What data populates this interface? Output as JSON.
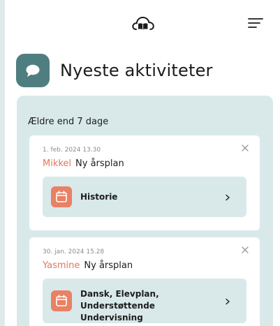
{
  "header": {
    "logo_icon": "cloud-book-icon",
    "menu_icon": "hamburger-menu-icon"
  },
  "page": {
    "title": "Nyeste aktiviteter",
    "title_icon": "chat-bubble-icon",
    "accent_color": "#4f7e80"
  },
  "activities": {
    "section_label": "Ældre end 7 dage",
    "items": [
      {
        "timestamp": "1. feb. 2024 13.30",
        "name": "Mikkel",
        "action": "Ny årsplan",
        "subject": "Historie",
        "close_icon": "close-icon",
        "subject_icon": "calendar-icon"
      },
      {
        "timestamp": "30. jan. 2024 15.28",
        "name": "Yasmine",
        "action": "Ny årsplan",
        "subject": "Dansk, Elevplan, Understøttende Undervisning",
        "close_icon": "close-icon",
        "subject_icon": "calendar-icon"
      }
    ]
  },
  "colors": {
    "name": "#e2765d",
    "panel": "#d9e9ea",
    "calendar": "#ea8064"
  }
}
